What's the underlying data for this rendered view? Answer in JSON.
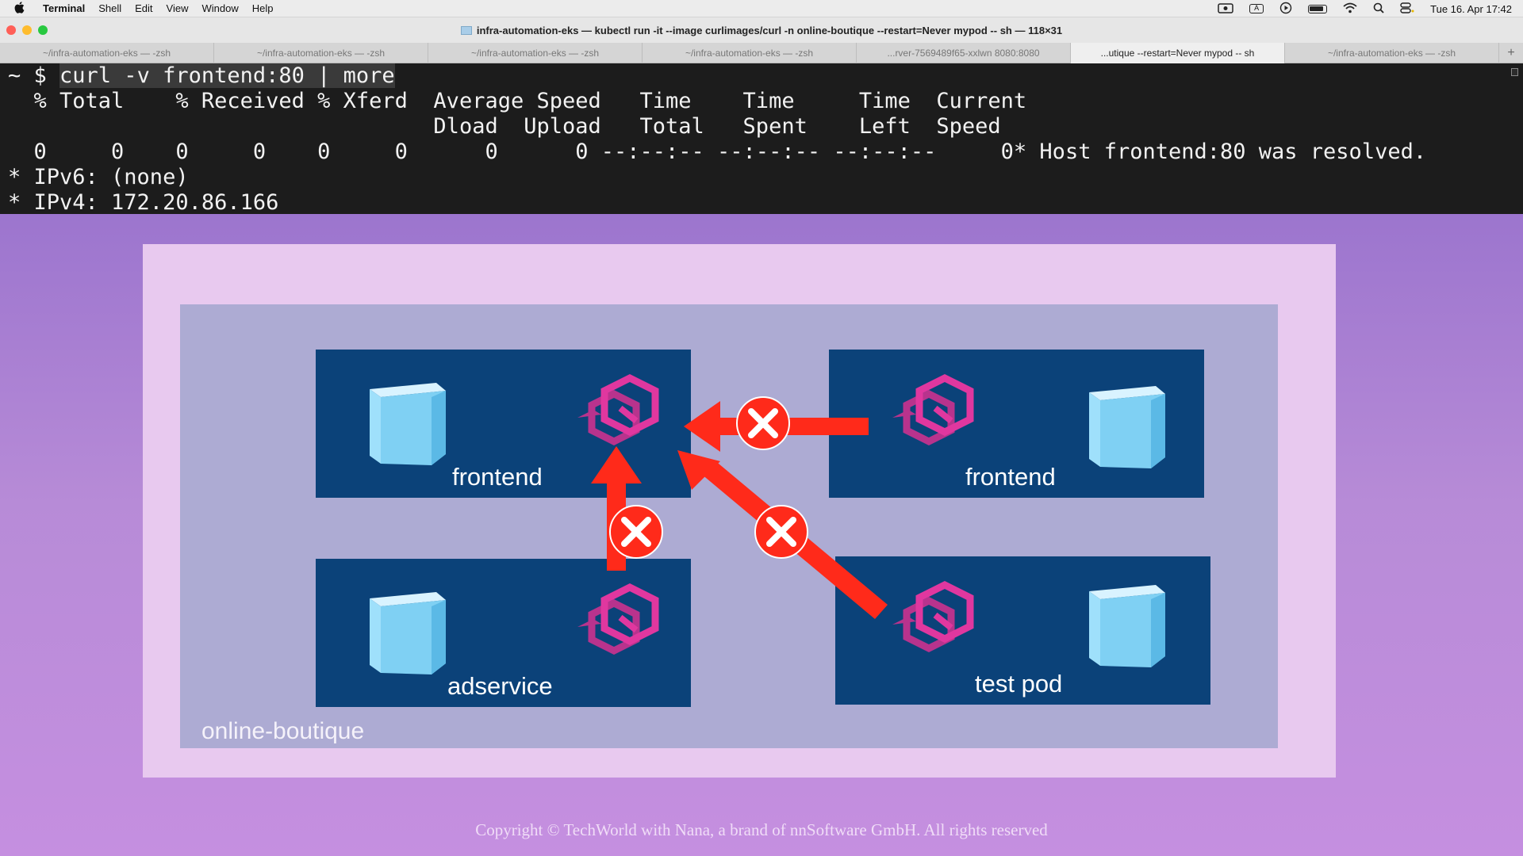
{
  "menubar": {
    "apple": "",
    "app_name": "Terminal",
    "menus": [
      "Shell",
      "Edit",
      "View",
      "Window",
      "Help"
    ],
    "input_indicator": "A",
    "datetime": "Tue 16. Apr 17:42"
  },
  "window": {
    "title": "infra-automation-eks — kubectl run -it --image curlimages/curl -n online-boutique --restart=Never mypod -- sh — 118×31"
  },
  "tabs": [
    {
      "label": "~/infra-automation-eks — -zsh"
    },
    {
      "label": "~/infra-automation-eks — -zsh"
    },
    {
      "label": "~/infra-automation-eks — -zsh"
    },
    {
      "label": "~/infra-automation-eks — -zsh"
    },
    {
      "label": "...rver-7569489f65-xxlwn 8080:8080"
    },
    {
      "label": "...utique --restart=Never mypod -- sh"
    },
    {
      "label": "~/infra-automation-eks — -zsh"
    }
  ],
  "tab_add": "+",
  "terminal": {
    "prompt": "~ $ ",
    "command": "curl -v frontend:80 | more",
    "lines": [
      "  % Total    % Received % Xferd  Average Speed   Time    Time     Time  Current",
      "                                 Dload  Upload   Total   Spent    Left  Speed",
      "  0     0    0     0    0     0      0      0 --:--:-- --:--:-- --:--:--     0* Host frontend:80 was resolved.",
      "* IPv6: (none)",
      "* IPv4: 172.20.86.166"
    ]
  },
  "slide": {
    "watermark": "",
    "namespace_label": "online-boutique",
    "nodes": {
      "frontend_left": "frontend",
      "frontend_right": "frontend",
      "adservice": "adservice",
      "test_pod": "test pod"
    },
    "copyright": "Copyright © TechWorld with Nana, a brand of nnSoftware GmbH. All rights reserved"
  },
  "colors": {
    "pod_box": "#0b4279",
    "namespace_box": "#adabd3",
    "arrow": "#ff2a1a",
    "envoy_icon": "#e0379f",
    "cube": "#7fd0f3"
  },
  "icons": [
    "apple-icon",
    "screen-record-icon",
    "play-icon",
    "battery-icon",
    "wifi-icon",
    "search-icon",
    "control-center-icon",
    "container-cube-icon",
    "envoy-proxy-icon",
    "blocked-x-icon"
  ]
}
